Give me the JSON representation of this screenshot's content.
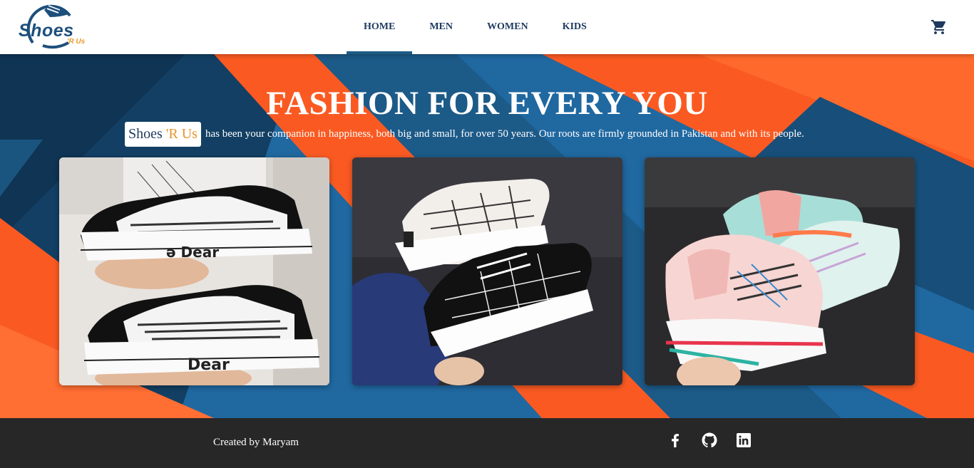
{
  "header": {
    "logo": {
      "main": "Shoes",
      "sub": "'R Us"
    },
    "nav": [
      {
        "label": "HOME",
        "active": true
      },
      {
        "label": "MEN",
        "active": false
      },
      {
        "label": "WOMEN",
        "active": false
      },
      {
        "label": "KIDS",
        "active": false
      }
    ],
    "cart_icon": "shopping-cart-icon"
  },
  "hero": {
    "title": "FASHION FOR EVERY YOU",
    "brand_chip": {
      "main": "Shoes",
      "accent": "'R Us"
    },
    "description": "has been your companion in happiness, both big and small, for over 50 years. Our roots are firmly grounded in Pakistan and with its people.",
    "cards": [
      {
        "name": "men-shoes-card"
      },
      {
        "name": "women-shoes-card"
      },
      {
        "name": "kids-shoes-card"
      }
    ]
  },
  "footer": {
    "credit": "Created by Maryam",
    "social": [
      "facebook-icon",
      "github-icon",
      "linkedin-icon"
    ]
  },
  "colors": {
    "primary_blue": "#1e3a5f",
    "hero_blue": "#1c5f8e",
    "hero_orange": "#fa5a22",
    "accent": "#e8952a",
    "footer": "#272727"
  }
}
